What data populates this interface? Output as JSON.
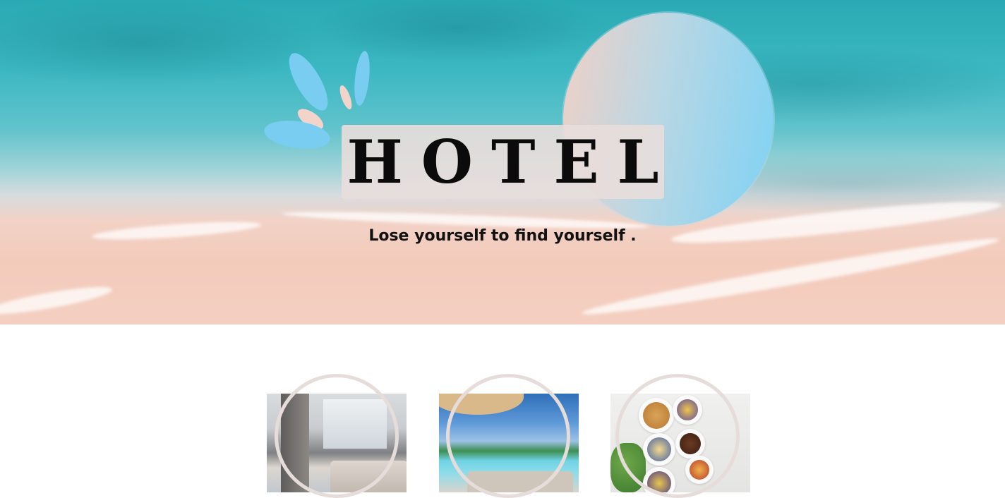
{
  "hero": {
    "title": "HOTEL",
    "tagline": "Lose yourself to find yourself ."
  },
  "colors": {
    "sun_start": "#f1d0c6",
    "sun_end": "#7fd2f4",
    "petal_blue": "#79cdf0",
    "petal_pink": "#f2d4cb",
    "title_box": "#e8dedc",
    "ring": "#e6dcda"
  },
  "cards": [
    {
      "name": "room",
      "image": "hotel-room-photo"
    },
    {
      "name": "pool",
      "image": "pool-photo"
    },
    {
      "name": "food",
      "image": "breakfast-photo"
    }
  ]
}
